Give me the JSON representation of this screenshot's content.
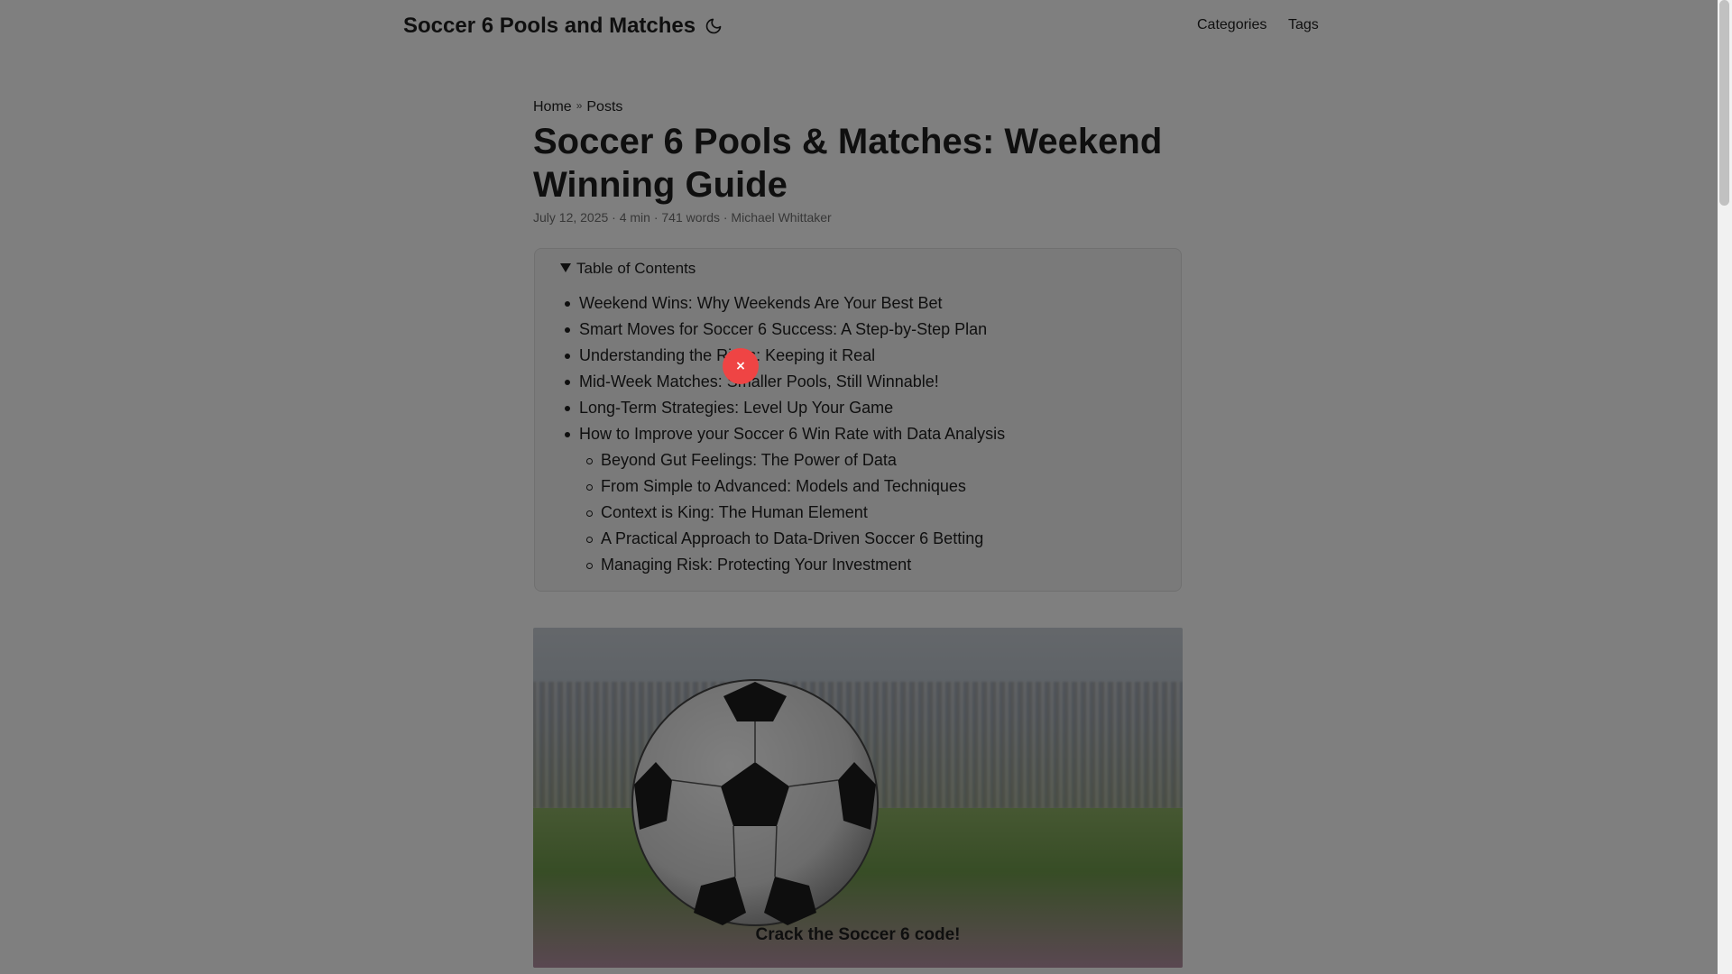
{
  "header": {
    "site_title": "Soccer 6 Pools and Matches",
    "theme_toggle_icon": "moon-icon",
    "nav": [
      {
        "label": "Categories"
      },
      {
        "label": "Tags"
      }
    ]
  },
  "breadcrumbs": {
    "home": "Home",
    "separator": "»",
    "current": "Posts"
  },
  "post": {
    "title": "Soccer 6 Pools & Matches: Weekend Winning Guide",
    "meta": "July 12, 2025 · 4 min · 741 words · Michael Whittaker"
  },
  "toc": {
    "summary": "Table of Contents",
    "items": [
      {
        "label": "Weekend Wins: Why Weekends Are Your Best Bet",
        "level": 1
      },
      {
        "label": "Smart Moves for Soccer 6 Success: A Step-by-Step Plan",
        "level": 1
      },
      {
        "label": "Understanding the Risks: Keeping it Real",
        "level": 1
      },
      {
        "label": "Mid-Week Matches: Smaller Pools, Still Winnable!",
        "level": 1
      },
      {
        "label": "Long-Term Strategies: Level Up Your Game",
        "level": 1
      },
      {
        "label": "How to Improve your Soccer 6 Win Rate with Data Analysis",
        "level": 1
      },
      {
        "label": "Beyond Gut Feelings: The Power of Data",
        "level": 2
      },
      {
        "label": "From Simple to Advanced: Models and Techniques",
        "level": 2
      },
      {
        "label": "Context is King: The Human Element",
        "level": 2
      },
      {
        "label": "A Practical Approach to Data-Driven Soccer 6 Betting",
        "level": 2
      },
      {
        "label": "Managing Risk: Protecting Your Investment",
        "level": 2
      }
    ]
  },
  "hero": {
    "caption": "Crack the Soccer 6 code!"
  },
  "overlay": {
    "close_label": "×"
  },
  "colors": {
    "overlay": "#000000",
    "close_button": "#ef4444"
  }
}
